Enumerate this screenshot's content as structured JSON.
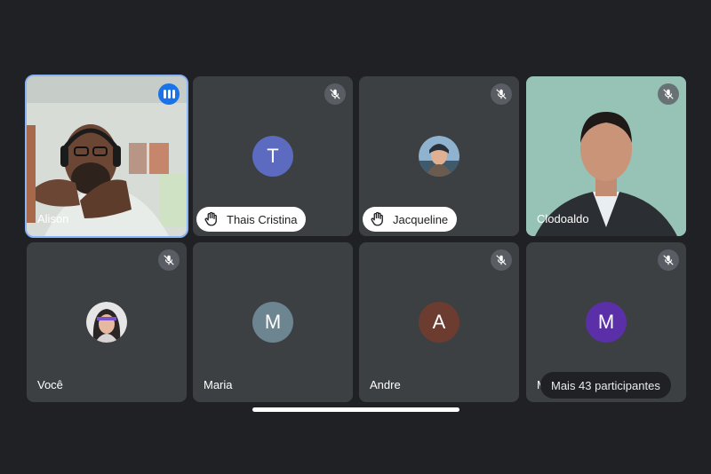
{
  "participants": {
    "alison": {
      "name": "Alison"
    },
    "thais": {
      "name": "Thais Cristina",
      "initial": "T"
    },
    "jacqueline": {
      "name": "Jacqueline"
    },
    "clodoaldo": {
      "name": "Clodoaldo"
    },
    "voce": {
      "name": "Você"
    },
    "maria": {
      "name": "Maria",
      "initial": "M"
    },
    "andre": {
      "name": "Andre",
      "initial": "A"
    },
    "m_hidden": {
      "initial": "M",
      "name_fragment": "M"
    }
  },
  "more_participants_label": "Mais 43 participantes",
  "colors": {
    "background": "#202124",
    "tile": "#3c4043",
    "active_outline": "#8ab4f8",
    "avatar_thais": "#5c6bc0",
    "avatar_maria": "#6d8591",
    "avatar_andre": "#6d3c30",
    "avatar_m": "#5b2fa8"
  },
  "icons": {
    "mute": "mic-off-icon",
    "speaking": "audio-level-icon",
    "hand": "raised-hand-icon"
  }
}
